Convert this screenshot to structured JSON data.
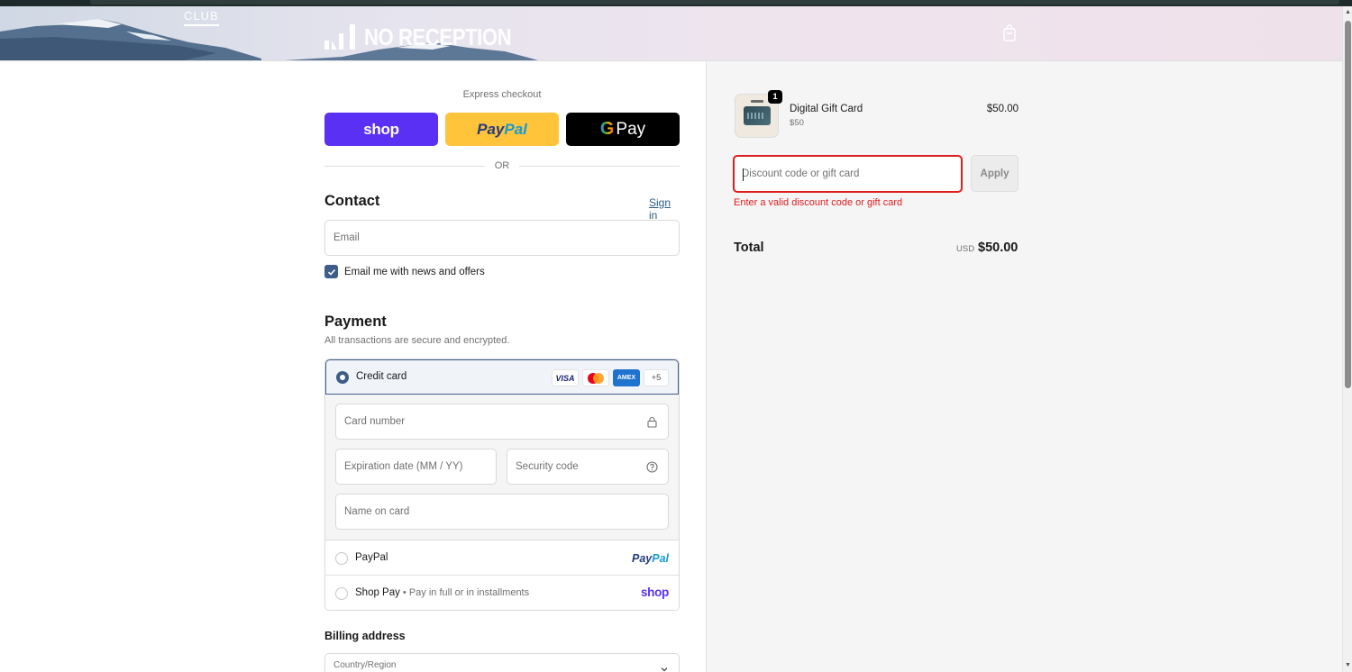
{
  "header": {
    "logo_text": "NO RECEPTION",
    "logo_club": "CLUB",
    "cart_icon": "shopping-bag-icon"
  },
  "express": {
    "label": "Express checkout",
    "shop_label": "shop",
    "paypal_label_1": "Pay",
    "paypal_label_2": "Pal",
    "gpay_g": "G",
    "gpay_label": "Pay",
    "or_label": "OR"
  },
  "contact": {
    "title": "Contact",
    "sign_in": "Sign in",
    "email_placeholder": "Email",
    "newsletter_label": "Email me with news and offers",
    "newsletter_checked": true
  },
  "payment": {
    "title": "Payment",
    "subtitle": "All transactions are secure and encrypted.",
    "credit_card_label": "Credit card",
    "card_brands": [
      "VISA",
      "MC",
      "AMEX"
    ],
    "more_brands": "+5",
    "card_number_placeholder": "Card number",
    "expiry_placeholder": "Expiration date (MM / YY)",
    "security_placeholder": "Security code",
    "name_placeholder": "Name on card",
    "paypal_label": "PayPal",
    "paypal_logo_1": "Pay",
    "paypal_logo_2": "Pal",
    "shoppay_label": "Shop Pay",
    "shoppay_sub": " • Pay in full or in installments",
    "shoppay_logo": "shop"
  },
  "billing": {
    "title": "Billing address",
    "country_label": "Country/Region"
  },
  "summary": {
    "product_name": "Digital Gift Card",
    "product_variant": "$50",
    "product_price": "$50.00",
    "quantity": "1",
    "discount_placeholder": "Discount code or gift card",
    "apply_label": "Apply",
    "error_text": "Enter a valid discount code or gift card",
    "total_label": "Total",
    "currency": "USD",
    "total_value": "$50.00"
  },
  "colors": {
    "accent": "#3e5d8a",
    "shop_purple": "#5a31f4",
    "paypal_yellow": "#ffc439",
    "error_red": "#dd1d1d"
  }
}
